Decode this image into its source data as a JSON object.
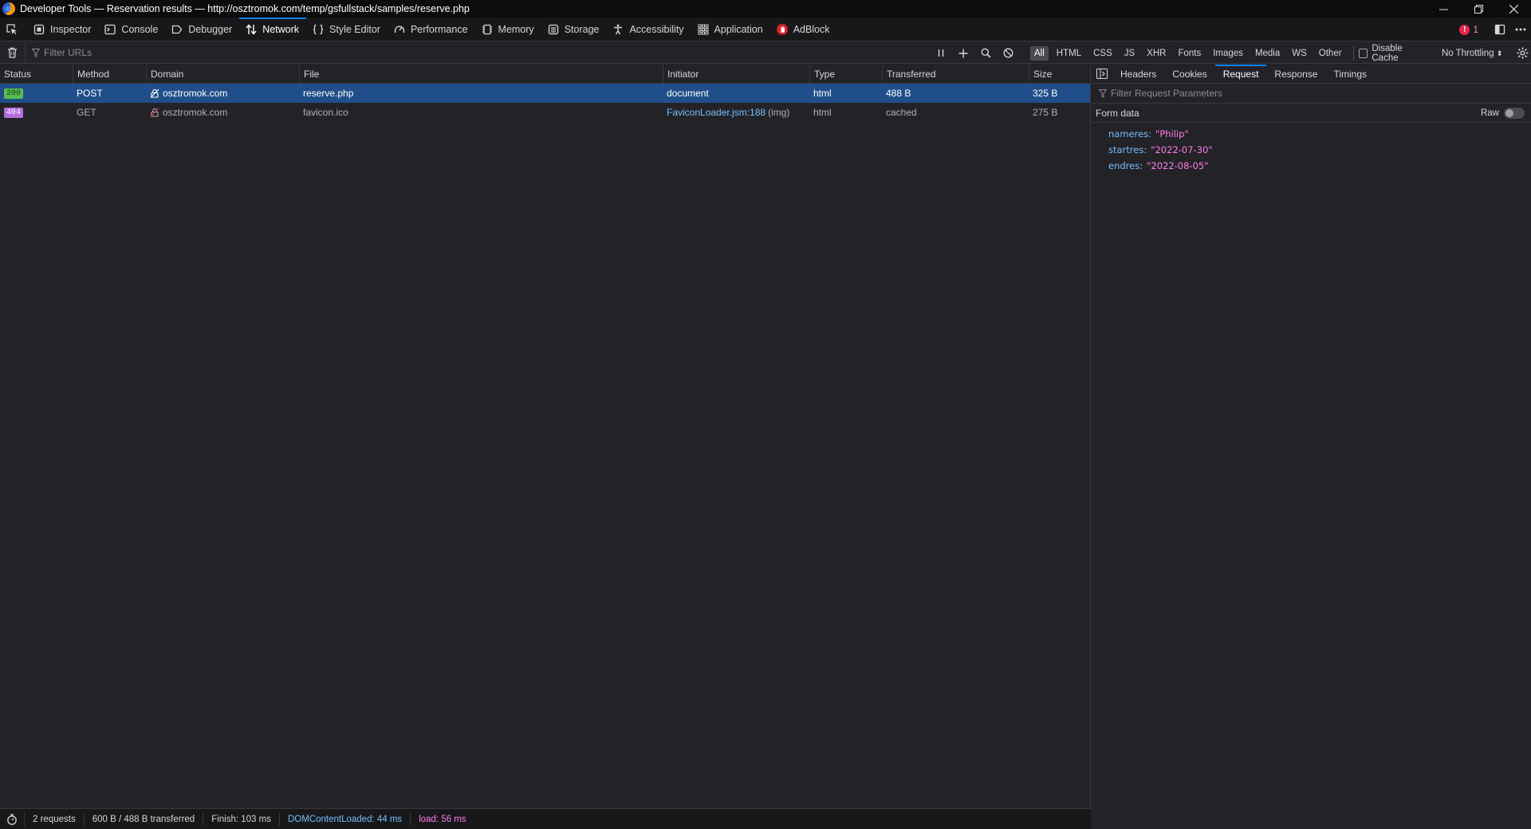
{
  "window": {
    "title": "Developer Tools — Reservation results — http://osztromok.com/temp/gsfullstack/samples/reserve.php"
  },
  "tools": [
    {
      "label": "Inspector",
      "icon": "inspector-icon",
      "active": false
    },
    {
      "label": "Console",
      "icon": "console-icon",
      "active": false
    },
    {
      "label": "Debugger",
      "icon": "debugger-icon",
      "active": false
    },
    {
      "label": "Network",
      "icon": "network-icon",
      "active": true
    },
    {
      "label": "Style Editor",
      "icon": "style-editor-icon",
      "active": false
    },
    {
      "label": "Performance",
      "icon": "performance-icon",
      "active": false
    },
    {
      "label": "Memory",
      "icon": "memory-icon",
      "active": false
    },
    {
      "label": "Storage",
      "icon": "storage-icon",
      "active": false
    },
    {
      "label": "Accessibility",
      "icon": "accessibility-icon",
      "active": false
    },
    {
      "label": "Application",
      "icon": "application-icon",
      "active": false
    },
    {
      "label": "AdBlock",
      "icon": "adblock-icon",
      "active": false
    }
  ],
  "error_count": "1",
  "filter": {
    "placeholder": "Filter URLs",
    "types": [
      "All",
      "HTML",
      "CSS",
      "JS",
      "XHR",
      "Fonts",
      "Images",
      "Media",
      "WS",
      "Other"
    ],
    "active_type": "All",
    "disable_cache_label": "Disable Cache",
    "throttling_label": "No Throttling"
  },
  "columns": [
    "Status",
    "Method",
    "Domain",
    "File",
    "Initiator",
    "Type",
    "Transferred",
    "Size"
  ],
  "requests": [
    {
      "status": "200",
      "method": "POST",
      "domain": "osztromok.com",
      "file": "reserve.php",
      "initiator": "document",
      "initiator_suffix": "",
      "type": "html",
      "transferred": "488 B",
      "size": "325 B",
      "selected": true
    },
    {
      "status": "404",
      "method": "GET",
      "domain": "osztromok.com",
      "file": "favicon.ico",
      "initiator": "FaviconLoader.jsm:188",
      "initiator_suffix": "(img)",
      "type": "html",
      "transferred": "cached",
      "size": "275 B",
      "selected": false
    }
  ],
  "statusbar": {
    "requests": "2 requests",
    "transferred": "600 B / 488 B transferred",
    "finish": "Finish: 103 ms",
    "dom_content_loaded": "DOMContentLoaded: 44 ms",
    "load": "load: 56 ms"
  },
  "details": {
    "tabs": [
      "Headers",
      "Cookies",
      "Request",
      "Response",
      "Timings"
    ],
    "active_tab": "Request",
    "filter_placeholder": "Filter Request Parameters",
    "section_title": "Form data",
    "raw_label": "Raw",
    "params": [
      {
        "key": "nameres:",
        "value": "\"Philip\""
      },
      {
        "key": "startres:",
        "value": "\"2022-07-30\""
      },
      {
        "key": "endres:",
        "value": "\"2022-08-05\""
      }
    ]
  },
  "colors": {
    "accent": "#0a84ff",
    "selected_row": "#204e8a",
    "status_200": "#57bd4f",
    "status_404": "#b26ddc",
    "link": "#75bfff",
    "value": "#ff7de9"
  }
}
